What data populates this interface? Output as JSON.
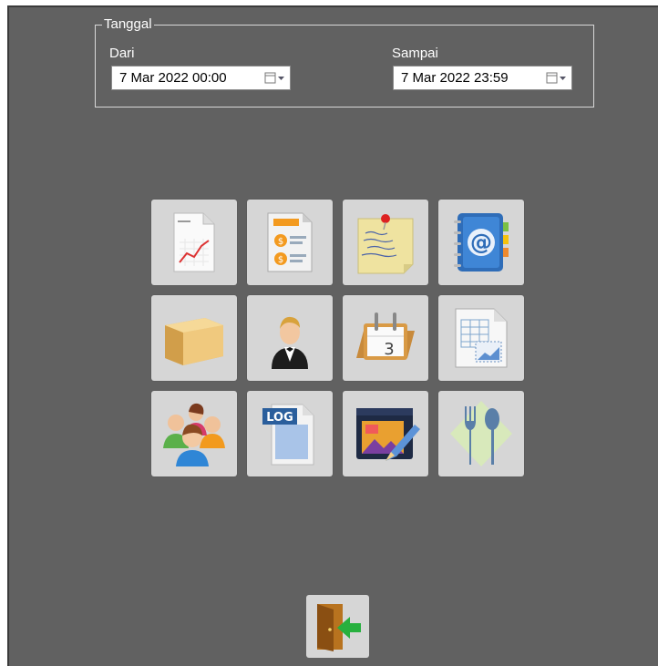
{
  "filter": {
    "legend": "Tanggal",
    "from_label": "Dari",
    "from_value": "7 Mar 2022 00:00",
    "to_label": "Sampai",
    "to_value": "7 Mar 2022 23:59"
  },
  "tiles": [
    {
      "icon": "line-report-icon"
    },
    {
      "icon": "finance-report-icon"
    },
    {
      "icon": "sticky-note-icon"
    },
    {
      "icon": "address-book-icon"
    },
    {
      "icon": "package-box-icon"
    },
    {
      "icon": "waiter-icon"
    },
    {
      "icon": "calendar-icon"
    },
    {
      "icon": "spreadsheet-chart-icon"
    },
    {
      "icon": "user-group-icon"
    },
    {
      "icon": "log-file-icon"
    },
    {
      "icon": "design-edit-icon"
    },
    {
      "icon": "fork-spoon-icon"
    }
  ],
  "exit": {
    "icon": "exit-door-icon"
  }
}
